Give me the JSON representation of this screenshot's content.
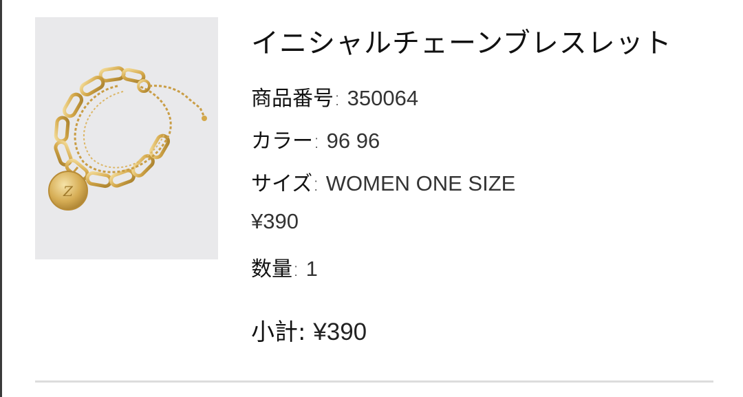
{
  "product": {
    "name": "イニシャルチェーンブレスレット",
    "image_alt": "イニシャルチェーンブレスレット",
    "details": [
      {
        "label": "商品番号",
        "value": "350064"
      },
      {
        "label": "カラー",
        "value": "96 96"
      },
      {
        "label": "サイズ",
        "value": "WOMEN ONE SIZE"
      }
    ],
    "price": "¥390",
    "quantity": {
      "label": "数量",
      "value": "1"
    },
    "subtotal": {
      "label": "小計",
      "value": "¥390"
    }
  },
  "separator": ":",
  "colors": {
    "image_bg": "#e9e9eb",
    "gold": "#d4a84a",
    "divider": "#dcdcdc"
  }
}
